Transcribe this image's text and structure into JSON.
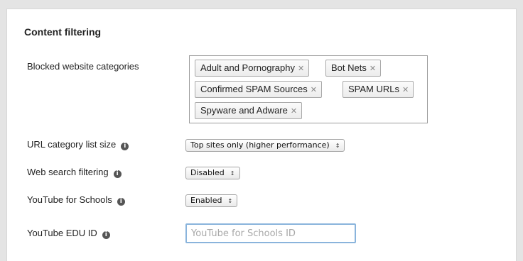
{
  "section": {
    "title": "Content filtering"
  },
  "blocked_categories": {
    "label": "Blocked website categories",
    "tags": [
      "Adult and Pornography",
      "Bot Nets",
      "Confirmed SPAM Sources",
      "SPAM URLs",
      "Spyware and Adware"
    ],
    "remove_glyph": "✕"
  },
  "url_list_size": {
    "label": "URL category list size",
    "value": "Top sites only (higher performance)"
  },
  "web_search": {
    "label": "Web search filtering",
    "value": "Disabled"
  },
  "youtube_schools": {
    "label": "YouTube for Schools",
    "value": "Enabled"
  },
  "youtube_edu": {
    "label": "YouTube EDU ID",
    "value": "",
    "placeholder": "YouTube for Schools ID"
  },
  "icons": {
    "info": "info-icon",
    "select_arrow": "updown-arrow-icon",
    "tag_remove": "close-icon"
  },
  "colors": {
    "background": "#e4e4e4",
    "panel": "#ffffff",
    "input_focus_border": "#8ab4dc"
  }
}
